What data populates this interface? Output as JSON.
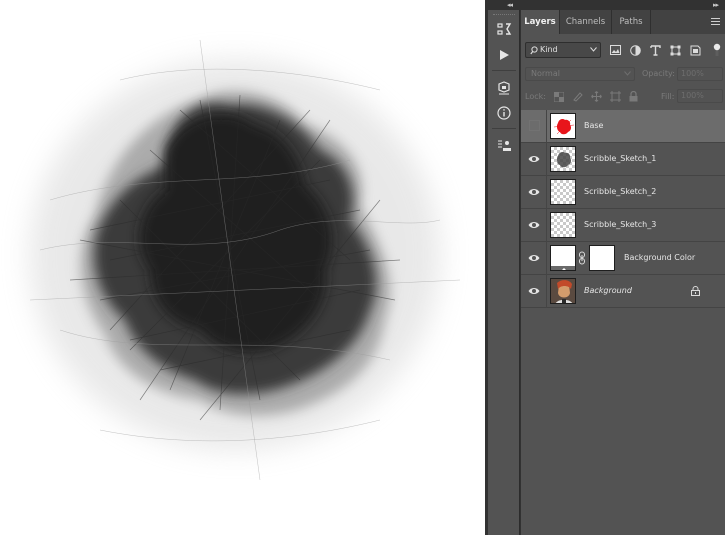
{
  "panel": {
    "tabs": [
      {
        "label": "Layers",
        "active": true
      },
      {
        "label": "Channels",
        "active": false
      },
      {
        "label": "Paths",
        "active": false
      }
    ],
    "filter": {
      "kind_label": "Kind"
    },
    "blend_mode": "Normal",
    "opacity_label": "Opacity:",
    "opacity_value": "100%",
    "lock_label": "Lock:",
    "fill_label": "Fill:",
    "fill_value": "100%"
  },
  "layers": [
    {
      "name": "Base",
      "visible": false,
      "selected": true,
      "thumb": "red-shape"
    },
    {
      "name": "Scribble_Sketch_1",
      "visible": true,
      "selected": false,
      "thumb": "sketch"
    },
    {
      "name": "Scribble_Sketch_2",
      "visible": true,
      "selected": false,
      "thumb": "transparent"
    },
    {
      "name": "Scribble_Sketch_3",
      "visible": true,
      "selected": false,
      "thumb": "transparent"
    },
    {
      "name": "Background Color",
      "visible": true,
      "selected": false,
      "thumb": "fill-with-mask"
    },
    {
      "name": "Background",
      "visible": true,
      "selected": false,
      "thumb": "photo",
      "locked": true
    }
  ],
  "colors": {
    "accent_red": "#e8151b",
    "panel_bg": "#535353",
    "selected_row": "#6c6c6c",
    "dock_bg": "#323232"
  },
  "icons": [
    "history-icon",
    "play-action-icon",
    "properties-icon",
    "info-icon",
    "layer-comps-icon",
    "search-icon",
    "pixel-filter-icon",
    "adjustment-filter-icon",
    "type-filter-icon",
    "shape-filter-icon",
    "smart-object-filter-icon",
    "eye-icon",
    "link-icon",
    "lock-icon",
    "panel-menu-icon"
  ]
}
